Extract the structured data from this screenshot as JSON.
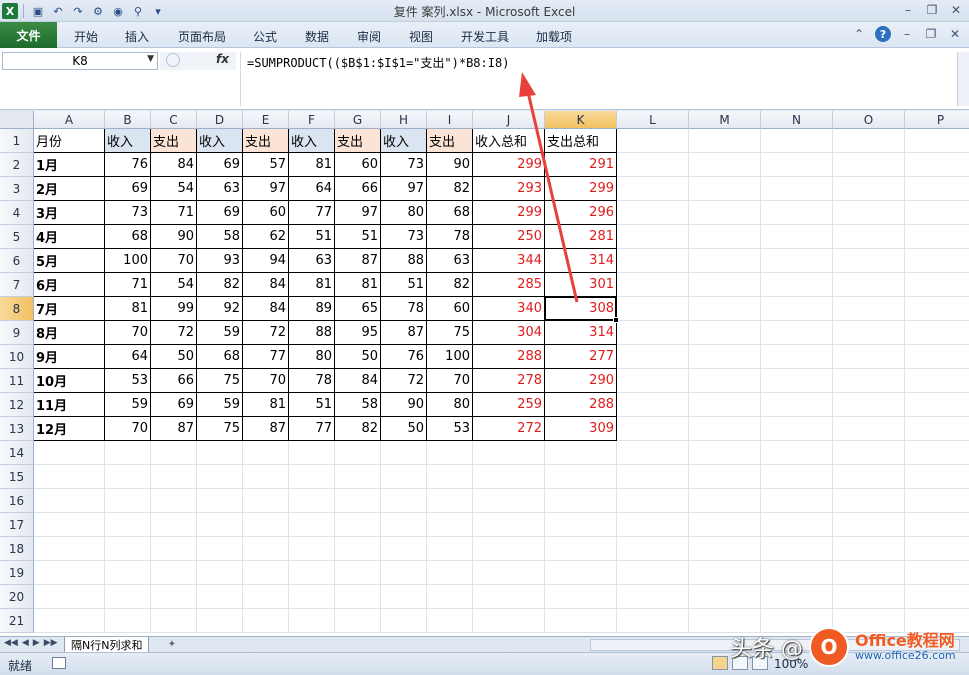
{
  "window": {
    "title": "复件 案列.xlsx  -  Microsoft Excel",
    "app_icon_label": "X"
  },
  "ribbon": {
    "tabs": [
      "文件",
      "开始",
      "插入",
      "页面布局",
      "公式",
      "数据",
      "审阅",
      "视图",
      "开发工具",
      "加载项"
    ]
  },
  "formula_bar": {
    "name_box": "K8",
    "fx_label": "fx",
    "formula": "=SUMPRODUCT(($B$1:$I$1=\"支出\")*B8:I8)"
  },
  "grid": {
    "columns": [
      "A",
      "B",
      "C",
      "D",
      "E",
      "F",
      "G",
      "H",
      "I",
      "J",
      "K",
      "L",
      "M",
      "N",
      "O",
      "P"
    ],
    "rows": [
      "1",
      "2",
      "3",
      "4",
      "5",
      "6",
      "7",
      "8",
      "9",
      "10",
      "11",
      "12",
      "13",
      "14",
      "15",
      "16",
      "17",
      "18",
      "19",
      "20",
      "21"
    ],
    "selected_cell": "K8",
    "header": [
      "月份",
      "收入",
      "支出",
      "收入",
      "支出",
      "收入",
      "支出",
      "收入",
      "支出",
      "收入总和",
      "支出总和"
    ],
    "data": [
      [
        "1月",
        "76",
        "84",
        "69",
        "57",
        "81",
        "60",
        "73",
        "90",
        "299",
        "291"
      ],
      [
        "2月",
        "69",
        "54",
        "63",
        "97",
        "64",
        "66",
        "97",
        "82",
        "293",
        "299"
      ],
      [
        "3月",
        "73",
        "71",
        "69",
        "60",
        "77",
        "97",
        "80",
        "68",
        "299",
        "296"
      ],
      [
        "4月",
        "68",
        "90",
        "58",
        "62",
        "51",
        "51",
        "73",
        "78",
        "250",
        "281"
      ],
      [
        "5月",
        "100",
        "70",
        "93",
        "94",
        "63",
        "87",
        "88",
        "63",
        "344",
        "314"
      ],
      [
        "6月",
        "71",
        "54",
        "82",
        "84",
        "81",
        "81",
        "51",
        "82",
        "285",
        "301"
      ],
      [
        "7月",
        "81",
        "99",
        "92",
        "84",
        "89",
        "65",
        "78",
        "60",
        "340",
        "308"
      ],
      [
        "8月",
        "70",
        "72",
        "59",
        "72",
        "88",
        "95",
        "87",
        "75",
        "304",
        "314"
      ],
      [
        "9月",
        "64",
        "50",
        "68",
        "77",
        "80",
        "50",
        "76",
        "100",
        "288",
        "277"
      ],
      [
        "10月",
        "53",
        "66",
        "75",
        "70",
        "78",
        "84",
        "72",
        "70",
        "278",
        "290"
      ],
      [
        "11月",
        "59",
        "69",
        "59",
        "81",
        "51",
        "58",
        "90",
        "80",
        "259",
        "288"
      ],
      [
        "12月",
        "70",
        "87",
        "75",
        "87",
        "77",
        "82",
        "50",
        "53",
        "272",
        "309"
      ]
    ]
  },
  "sheets": {
    "active": "隔N行N列求和"
  },
  "status": {
    "ready": "就绪",
    "zoom": "100%"
  },
  "watermark": {
    "text": "头条 @",
    "logo_letter": "O",
    "brand": "Office教程网",
    "url": "www.office26.com"
  },
  "colors": {
    "income_header": "#dbe5f1",
    "expense_header": "#fbe4d5",
    "total_text": "#e01b1b",
    "arrow": "#e8413c",
    "file_tab": "#1d6b2c"
  }
}
